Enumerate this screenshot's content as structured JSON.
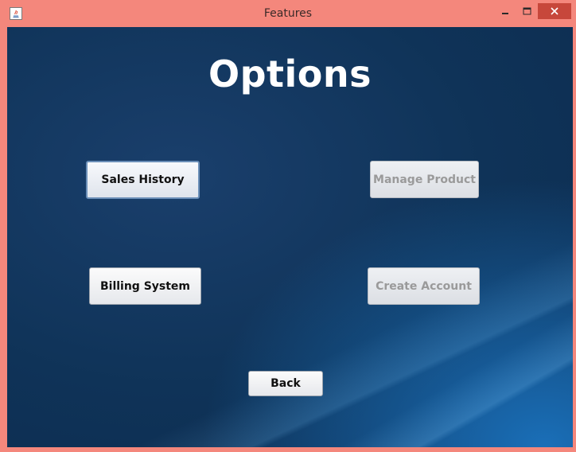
{
  "window": {
    "title": "Features",
    "icon": "java-icon",
    "controls": {
      "minimize": "▁",
      "maximize": "□",
      "close": "✕"
    }
  },
  "content": {
    "heading": "Options",
    "buttons": {
      "sales_history": "Sales History",
      "manage_product": "Manage Product",
      "billing_system": "Billing System",
      "create_account": "Create Account",
      "back": "Back"
    }
  },
  "colors": {
    "frame": "#f4877c",
    "close_button": "#c7473b",
    "background_dark": "#0f3358",
    "heading_text": "#ffffff"
  }
}
